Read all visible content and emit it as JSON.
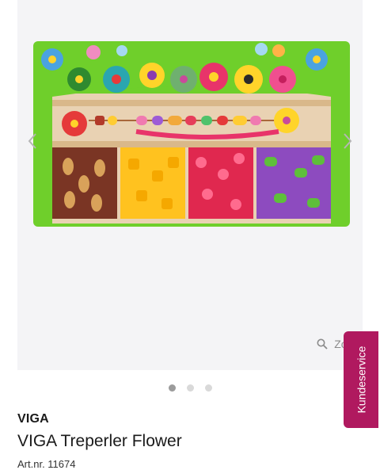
{
  "product": {
    "brand": "VIGA",
    "title": "VIGA Treperler Flower",
    "artno": "Art.nr. 11674"
  },
  "gallery": {
    "zoom_label": "Zoom",
    "image_alt": "VIGA Treperler Flower product image",
    "dot_count": 3,
    "active_dot": 1
  },
  "customer_service": {
    "label": "Kundeservice"
  },
  "colors": {
    "accent": "#b0195f",
    "frame_green": "#6fcf2b"
  },
  "icons": [
    "chevron-left-icon",
    "chevron-right-icon",
    "zoom-icon"
  ]
}
